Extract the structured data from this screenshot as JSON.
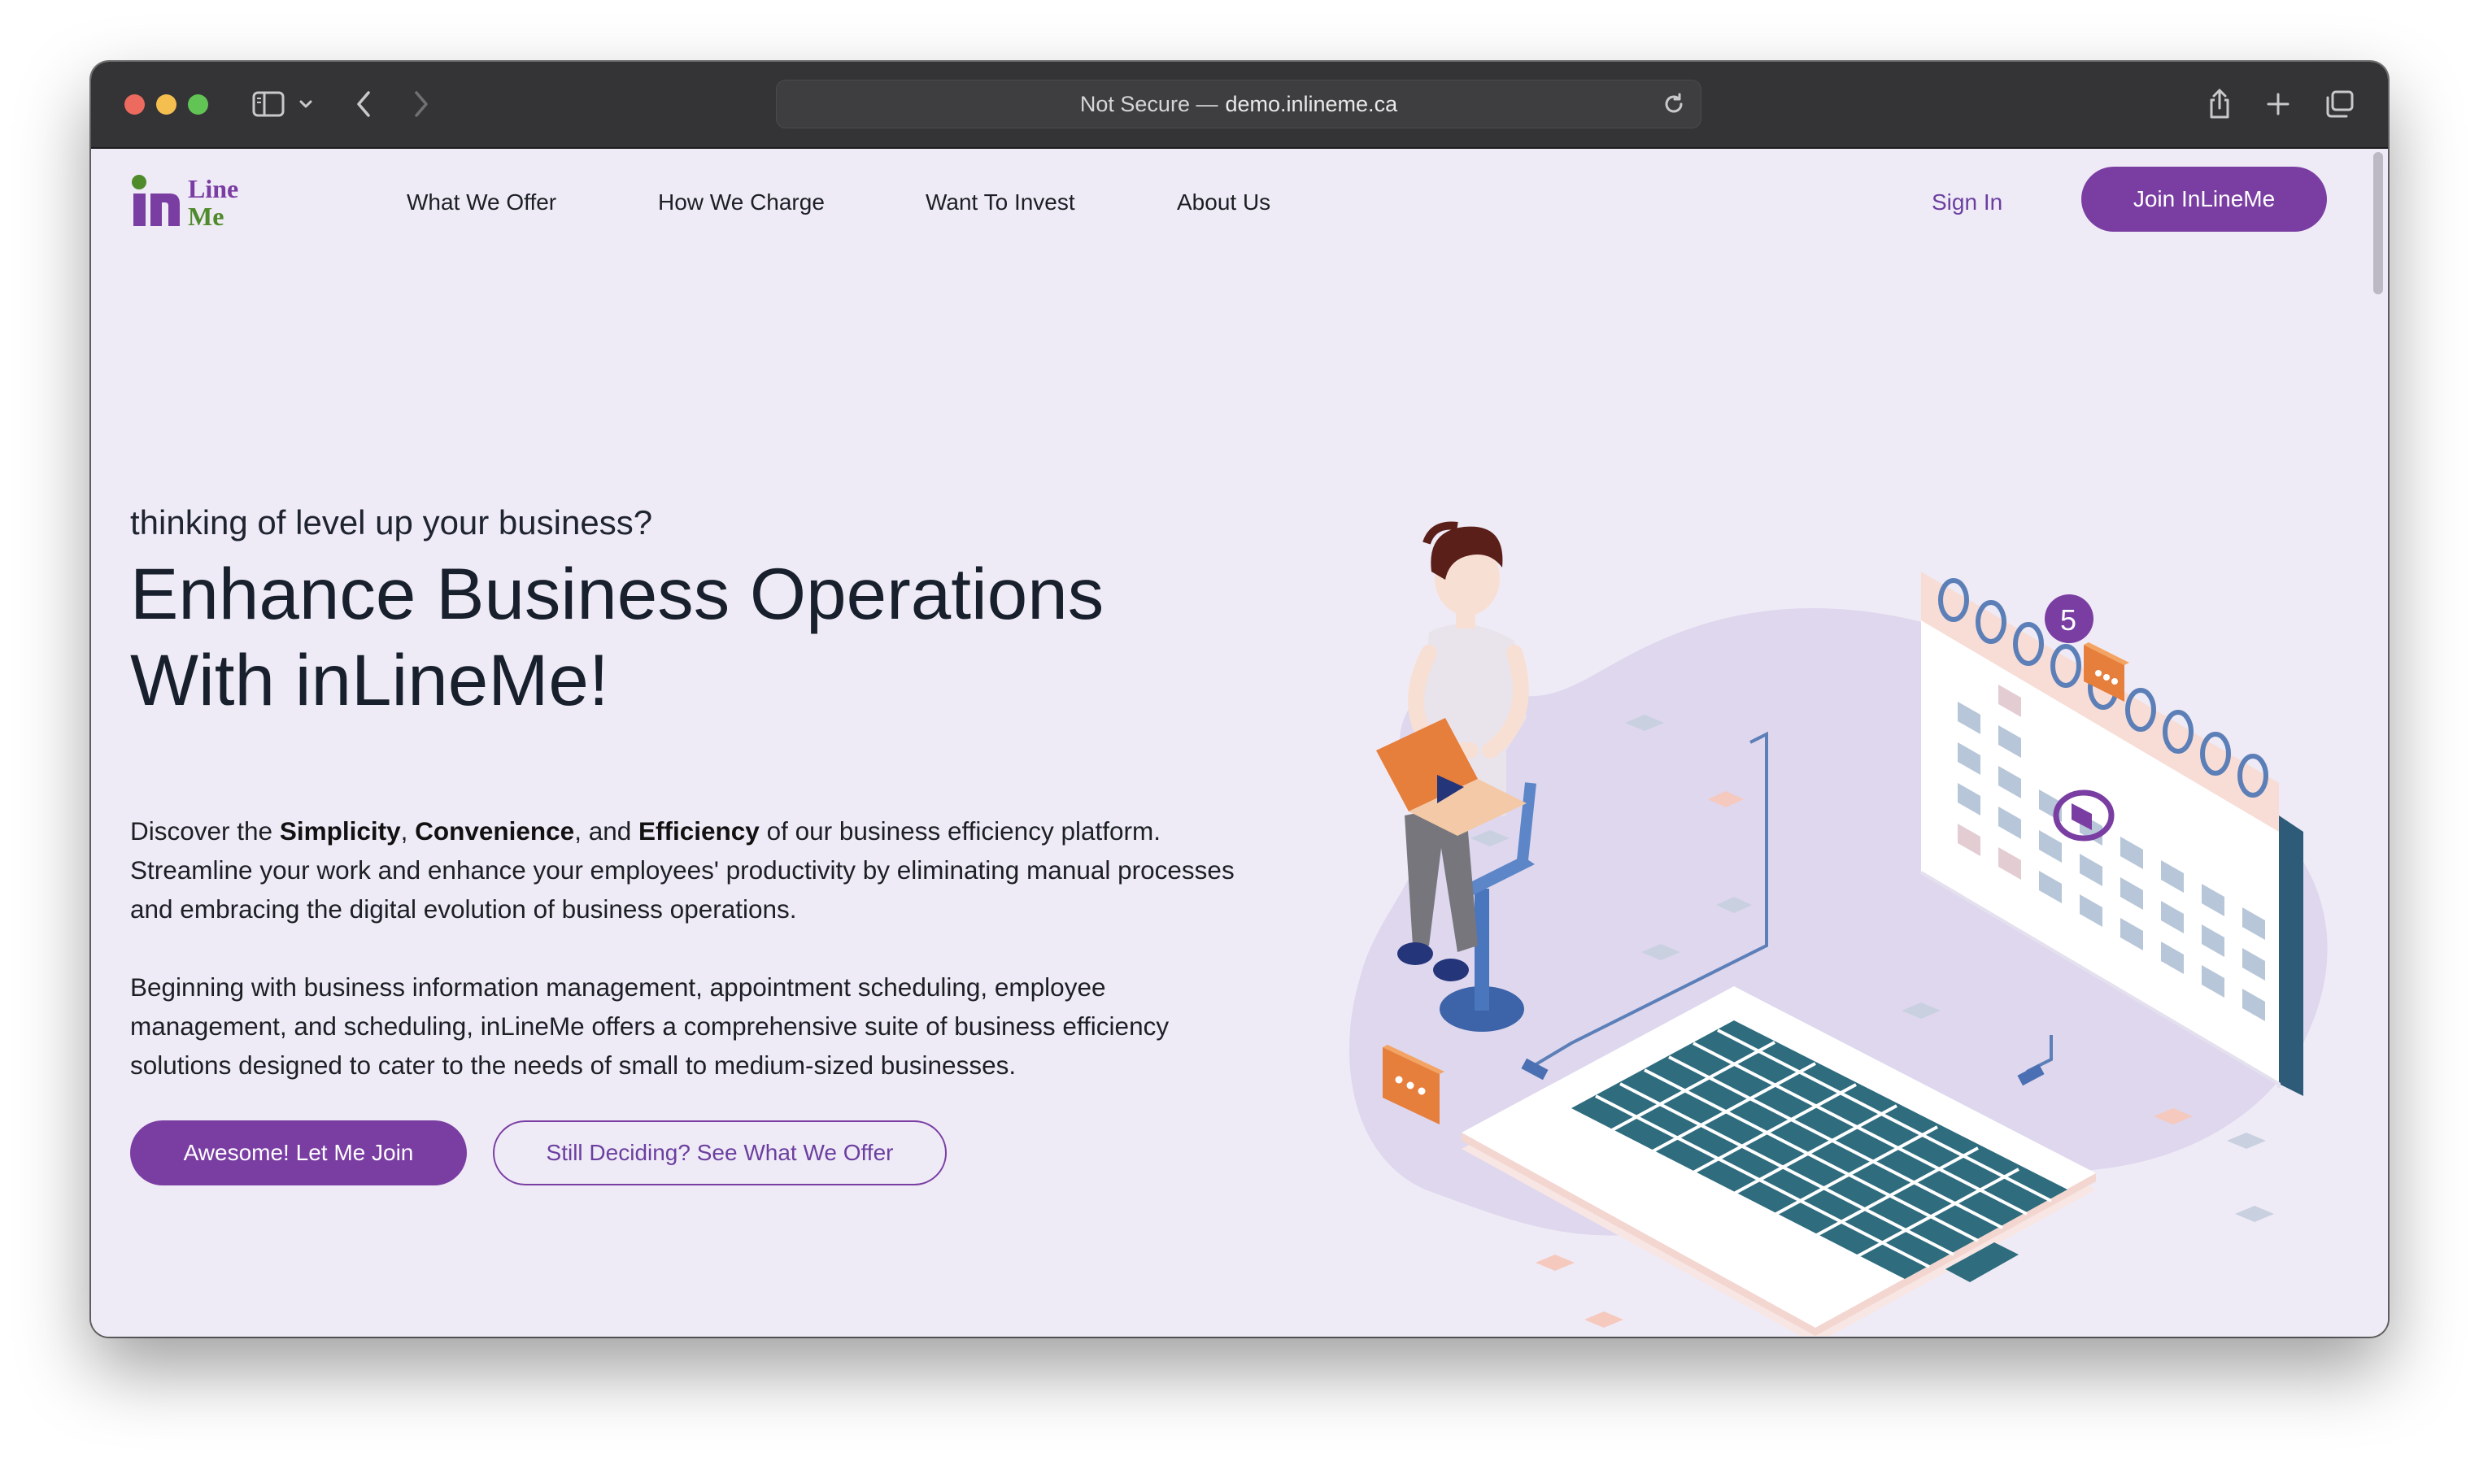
{
  "browser": {
    "address_prefix": "Not Secure —",
    "address_domain": "demo.inlineme.ca"
  },
  "logo": {
    "mark": "in",
    "word_top": "Line",
    "word_bottom": "Me"
  },
  "nav": {
    "items": [
      {
        "label": "What We Offer"
      },
      {
        "label": "How We Charge"
      },
      {
        "label": "Want To Invest"
      },
      {
        "label": "About Us"
      }
    ],
    "sign_in": "Sign In",
    "join": "Join InLineMe"
  },
  "hero": {
    "tagline": "thinking of level up your business?",
    "headline_line1": "Enhance Business Operations",
    "headline_line2": "With inLineMe!",
    "p1": {
      "pre": "Discover the ",
      "b1": "Simplicity",
      "sep1": ", ",
      "b2": "Convenience",
      "sep2": ", and ",
      "b3": "Efficiency",
      "post": " of our business efficiency platform. Streamline your work and enhance your employees' productivity by eliminating manual processes and embracing the digital evolution of business operations."
    },
    "p2": "Beginning with business information management, appointment scheduling, employee management, and scheduling, inLineMe offers a comprehensive suite of business efficiency solutions designed to cater to the needs of small to medium-sized businesses.",
    "cta_primary": "Awesome! Let Me Join",
    "cta_secondary": "Still Deciding? See What We Offer"
  },
  "illustration": {
    "notification_count": "5"
  },
  "colors": {
    "accent": "#7a3ea3",
    "page_bg": "#efebf6",
    "logo_green": "#4f8a2b",
    "chrome": "#343436"
  }
}
